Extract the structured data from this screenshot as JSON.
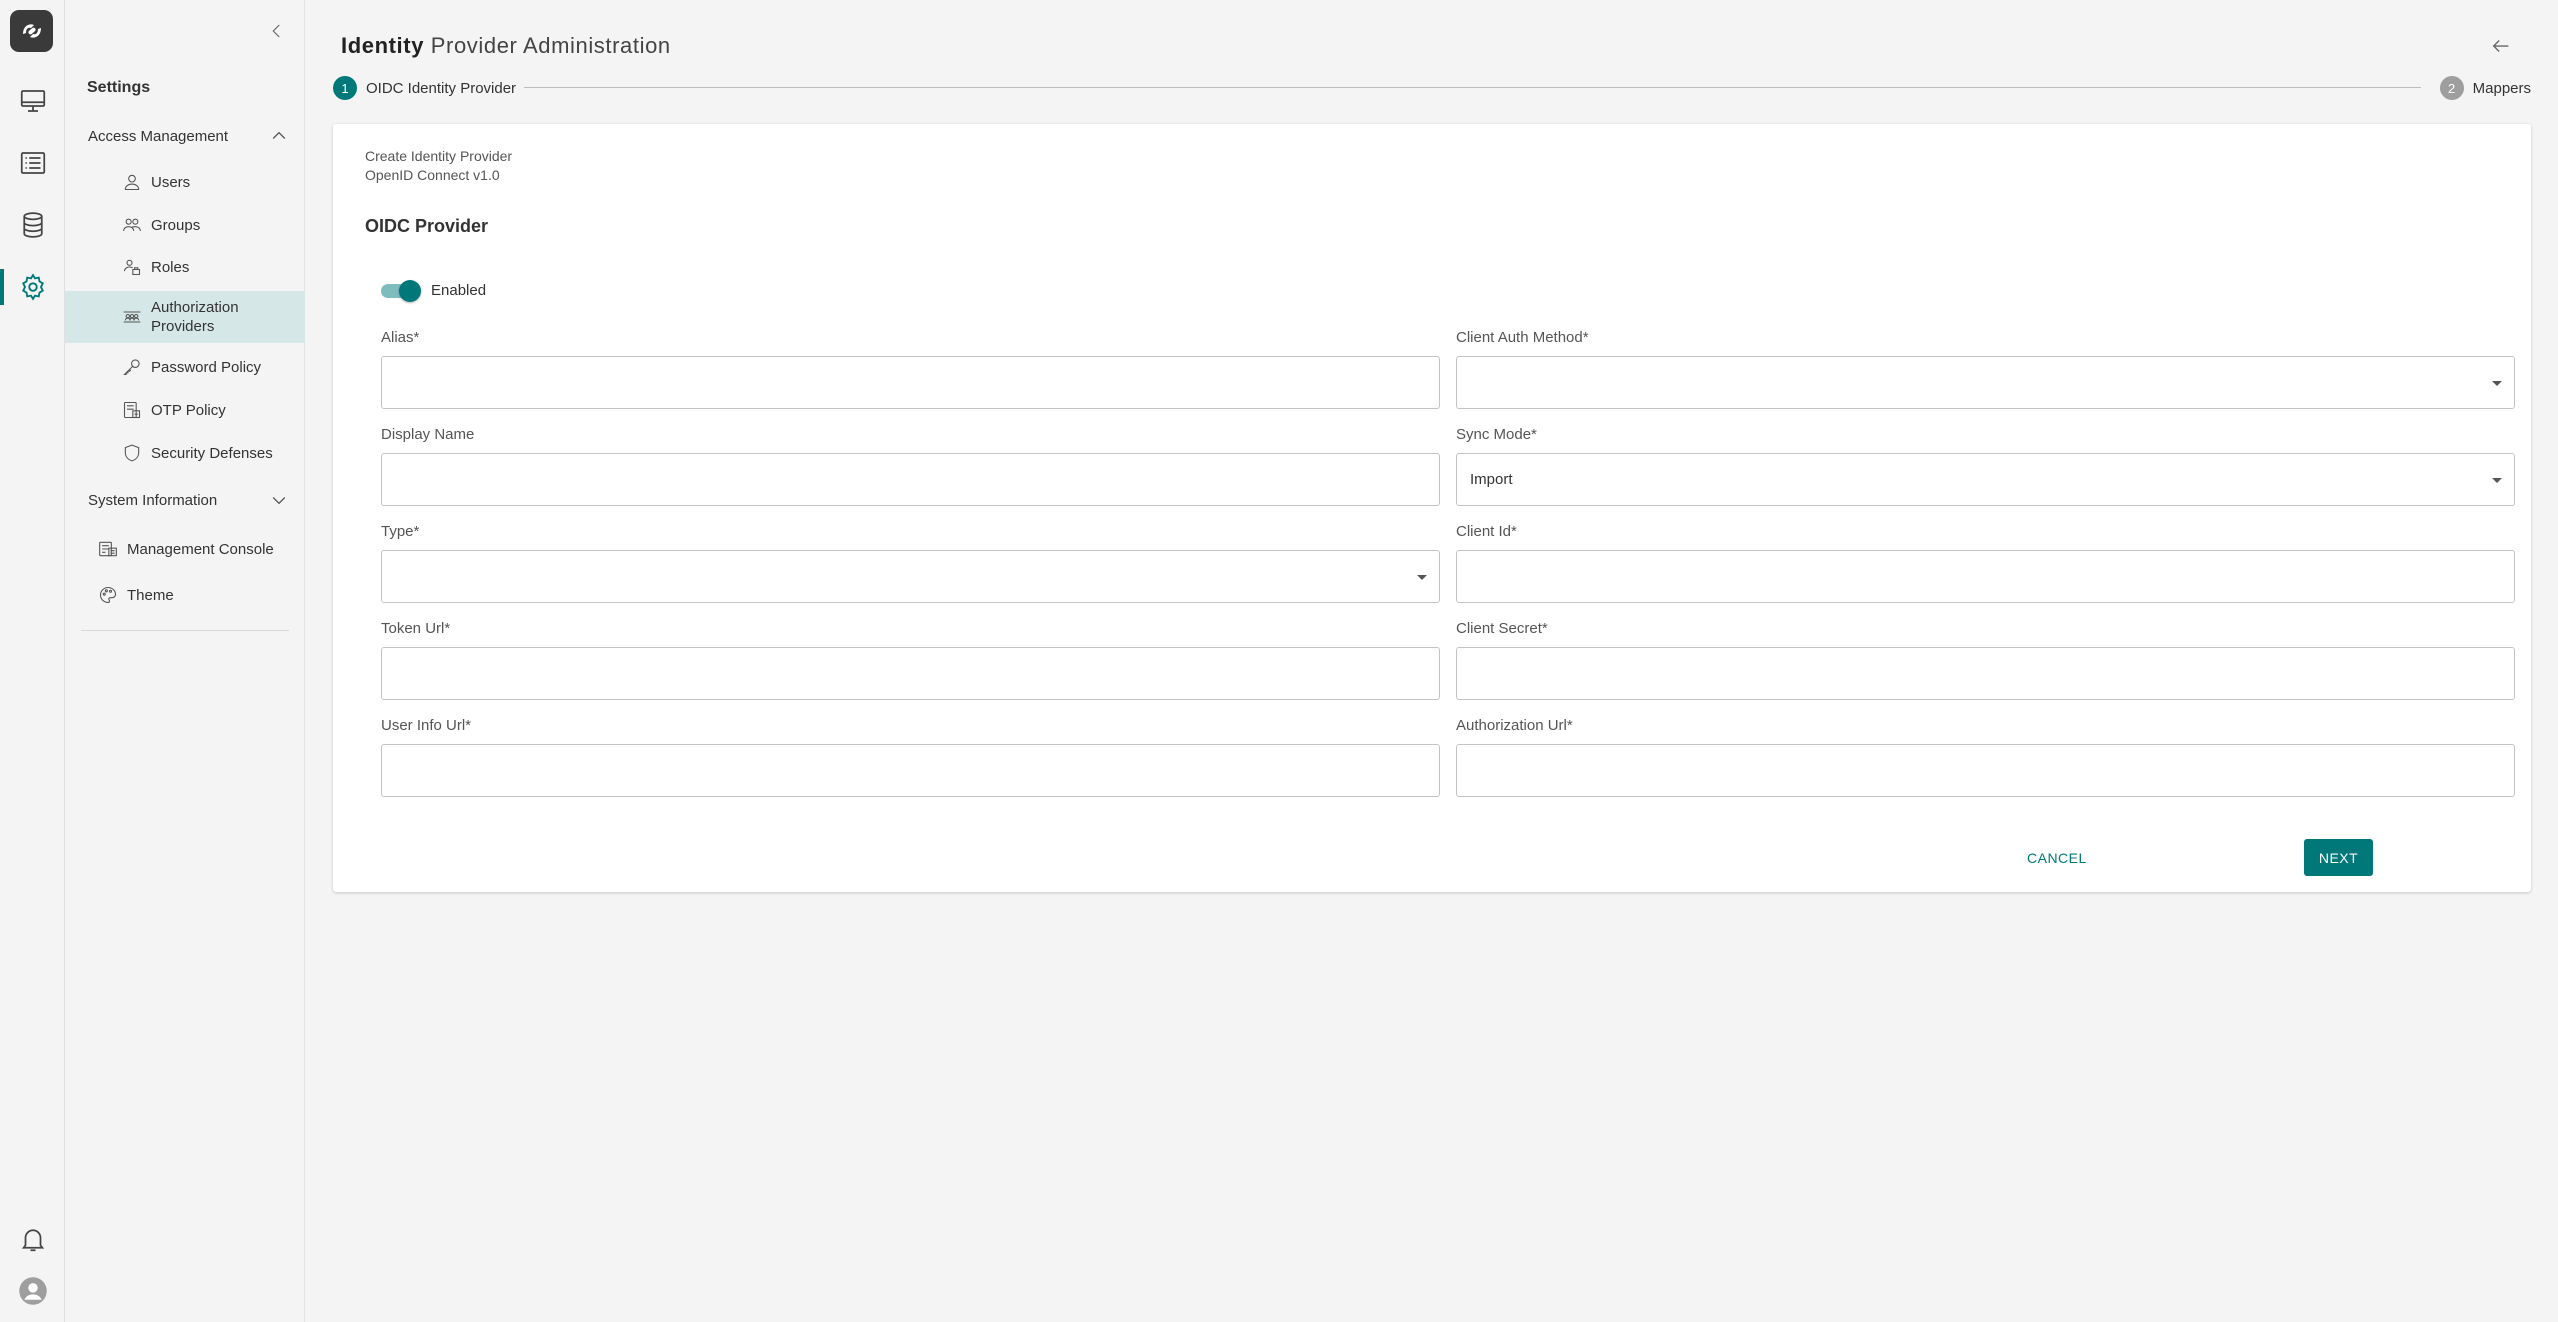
{
  "rail": {
    "items": [
      {
        "name": "monitor-icon"
      },
      {
        "name": "list-icon"
      },
      {
        "name": "database-icon"
      },
      {
        "name": "gear-icon",
        "active": true
      }
    ],
    "bottom": [
      {
        "name": "bell-icon"
      },
      {
        "name": "user-avatar-icon"
      }
    ]
  },
  "sidebar": {
    "title": "Settings",
    "access_group": "Access Management",
    "access_items": [
      {
        "label": "Users",
        "icon": "user-icon"
      },
      {
        "label": "Groups",
        "icon": "groups-icon"
      },
      {
        "label": "Roles",
        "icon": "roles-icon"
      },
      {
        "label": "Authorization Providers",
        "icon": "authorization-providers-icon",
        "active": true
      },
      {
        "label": "Password Policy",
        "icon": "key-icon"
      },
      {
        "label": "OTP Policy",
        "icon": "otp-icon"
      },
      {
        "label": "Security Defenses",
        "icon": "shield-icon"
      }
    ],
    "system_group": "System Information",
    "system_items": [
      {
        "label": "Management Console",
        "icon": "console-icon"
      },
      {
        "label": "Theme",
        "icon": "palette-icon"
      }
    ]
  },
  "header": {
    "title_bold": "Identity",
    "title_rest": " Provider Administration"
  },
  "stepper": {
    "steps": [
      {
        "number": "1",
        "label": "OIDC Identity Provider",
        "active": true
      },
      {
        "number": "2",
        "label": "Mappers",
        "active": false
      }
    ]
  },
  "form": {
    "subtitle_1": "Create Identity Provider",
    "subtitle_2": "OpenID Connect v1.0",
    "heading": "OIDC Provider",
    "enabled_label": "Enabled",
    "enabled": true,
    "fields": {
      "alias": {
        "label": "Alias*",
        "value": ""
      },
      "client_auth_method": {
        "label": "Client Auth Method*",
        "value": ""
      },
      "display_name": {
        "label": "Display Name",
        "value": ""
      },
      "sync_mode": {
        "label": "Sync Mode*",
        "value": "Import"
      },
      "type": {
        "label": "Type*",
        "value": ""
      },
      "client_id": {
        "label": "Client Id*",
        "value": ""
      },
      "token_url": {
        "label": "Token Url*",
        "value": ""
      },
      "client_secret": {
        "label": "Client Secret*",
        "value": ""
      },
      "user_info_url": {
        "label": "User Info Url*",
        "value": ""
      },
      "authorization_url": {
        "label": "Authorization Url*",
        "value": ""
      }
    },
    "cancel_label": "CANCEL",
    "next_label": "NEXT"
  },
  "colors": {
    "accent": "#00787a",
    "active_bg": "#d6e7e8",
    "background": "#f4f4f4"
  }
}
